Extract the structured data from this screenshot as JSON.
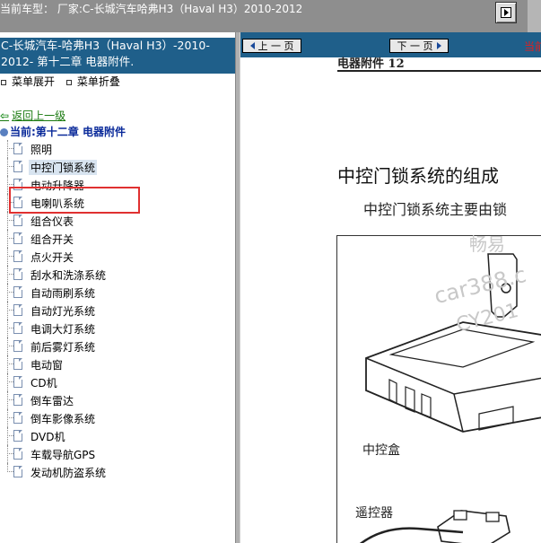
{
  "top_bar": {
    "title": "当前车型： 厂家:C-长城汽车哈弗H3（Haval H3）2010-2012"
  },
  "sidebar": {
    "banner_line1": "C-长城汽车-哈弗H3（Haval H3）-2010-",
    "banner_line2": "2012- 第十二章 电器附件.",
    "expand_label": "菜单展开",
    "collapse_label": "菜单折叠",
    "back_label": "返回上一级",
    "current_label": "当前:第十二章 电器附件",
    "items": [
      {
        "label": "照明"
      },
      {
        "label": "中控门锁系统"
      },
      {
        "label": "电动升降器"
      },
      {
        "label": "电喇叭系统"
      },
      {
        "label": "组合仪表"
      },
      {
        "label": "组合开关"
      },
      {
        "label": "点火开关"
      },
      {
        "label": "刮水和洗涤系统"
      },
      {
        "label": "自动雨刷系统"
      },
      {
        "label": "自动灯光系统"
      },
      {
        "label": "电调大灯系统"
      },
      {
        "label": "前后雾灯系统"
      },
      {
        "label": "电动窗"
      },
      {
        "label": "CD机"
      },
      {
        "label": "倒车雷达"
      },
      {
        "label": "倒车影像系统"
      },
      {
        "label": "DVD机"
      },
      {
        "label": "车载导航GPS"
      },
      {
        "label": "发动机防盗系统"
      }
    ],
    "selected_index": 1
  },
  "content": {
    "prev_label": "上 一 页",
    "next_label": "下 一 页",
    "current_page_label": "当前",
    "doc_header": "电器附件  12",
    "doc_title": "中控门锁系统的组成",
    "doc_subtitle": "中控门锁系统主要由锁",
    "watermark_1": "畅易",
    "watermark_2": "car388.c",
    "watermark_3": "CY201",
    "figure_label_box": "中控盒",
    "figure_label_remote": "遥控器"
  },
  "colors": {
    "banner_bg": "#1f5f8a",
    "top_bar_bg": "#8e8e8e",
    "highlight_border": "#e03030",
    "back_link": "#1a7a10",
    "current_label": "#0a2a9a"
  }
}
